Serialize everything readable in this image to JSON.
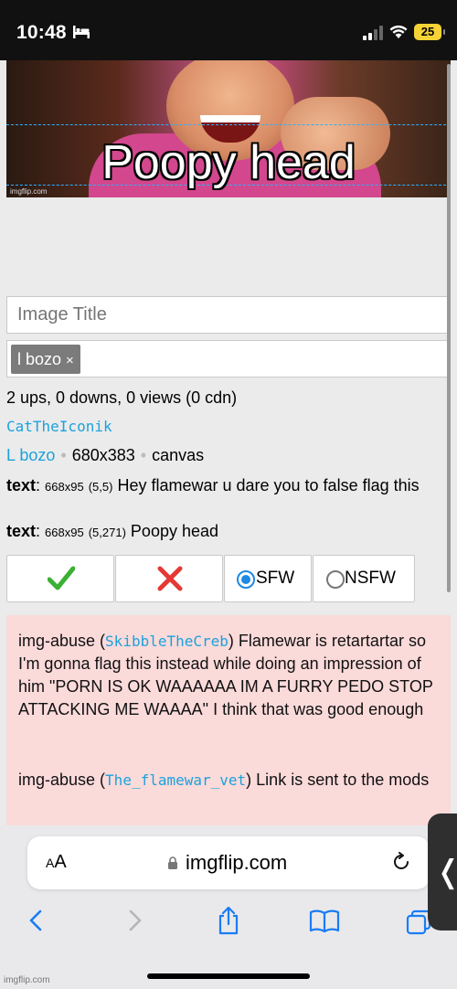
{
  "status_bar": {
    "time": "10:48",
    "battery": "25",
    "icons": [
      "bed-icon",
      "cellular-signal-icon",
      "wifi-icon",
      "battery-icon"
    ]
  },
  "meme": {
    "caption": "Poopy head",
    "watermark": "imgflip.com"
  },
  "form": {
    "title_placeholder": "Image Title",
    "tag": "l bozo",
    "tag_remove": "×"
  },
  "stats": "2 ups, 0 downs, 0 views (0 cdn)",
  "author": "CatTheIconik",
  "meta": {
    "template_link": "L bozo",
    "dimensions": "680x383",
    "type": "canvas"
  },
  "text_boxes": [
    {
      "label": "text",
      "size": "668x95",
      "position": "(5,5)",
      "value": "Hey flamewar u dare you to false flag this"
    },
    {
      "label": "text",
      "size": "668x95",
      "position": "(5,271)",
      "value": "Poopy head"
    }
  ],
  "moderation": {
    "sfw_label": "SFW",
    "nsfw_label": "NSFW",
    "selected": "SFW",
    "colors": {
      "approve": "#3cb034",
      "reject": "#e53935",
      "radio_selected": "#1e88e5"
    }
  },
  "abuse_reports": [
    {
      "type": "img-abuse",
      "user": "SkibbleTheCreb",
      "message": "Flamewar is retartartar so I'm gonna flag this instead while doing an impression of him \"PORN IS OK WAAAAAA IM A FURRY PEDO STOP ATTACKING ME WAAAA\" I think that was good enough"
    },
    {
      "type": "img-abuse",
      "user": "The_flamewar_vet",
      "message": "Link is sent to the mods"
    }
  ],
  "browser": {
    "aa_label_small": "A",
    "aa_label_big": "A",
    "domain": "imgflip.com",
    "side_tab_glyph": "❬"
  },
  "footer_watermark": "imgflip.com"
}
